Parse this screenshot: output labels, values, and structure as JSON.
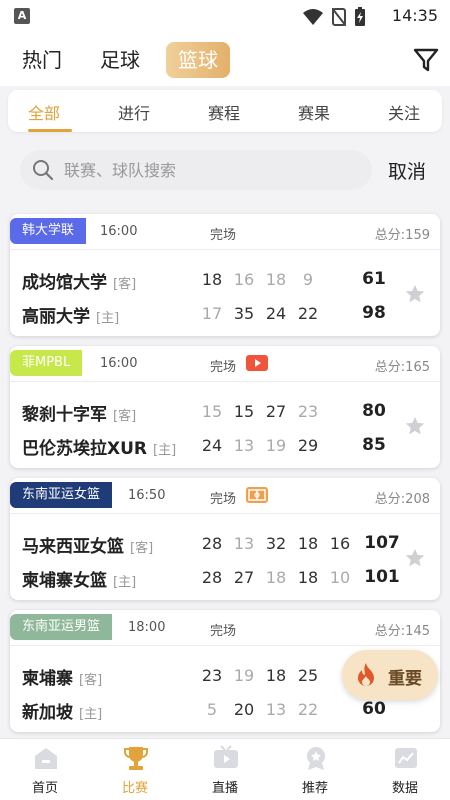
{
  "statusbar": {
    "app_badge": "A",
    "time": "14:35"
  },
  "top_tabs": [
    "热门",
    "足球",
    "篮球"
  ],
  "top_active": "篮球",
  "sub_tabs": [
    "全部",
    "进行",
    "赛程",
    "赛果",
    "关注"
  ],
  "search": {
    "placeholder": "联赛、球队搜索",
    "cancel": "取消"
  },
  "matches": [
    {
      "league": "韩大学联",
      "league_color": "#5b6ae8",
      "time": "16:00",
      "status": "完场",
      "total": "总分:159",
      "away": {
        "name": "成均馆大学",
        "side": "[客]",
        "q": [
          "18",
          "16",
          "18",
          "9"
        ],
        "total": "61"
      },
      "home": {
        "name": "高丽大学",
        "side": "[主]",
        "q": [
          "17",
          "35",
          "24",
          "22"
        ],
        "total": "98"
      }
    },
    {
      "league": "菲MPBL",
      "league_color": "#c7e84a",
      "time": "16:00",
      "status": "完场",
      "icon": "video-icon",
      "total": "总分:165",
      "away": {
        "name": "黎刹十字军",
        "side": "[客]",
        "q": [
          "15",
          "15",
          "27",
          "23"
        ],
        "total": "80"
      },
      "home": {
        "name": "巴伦苏埃拉XUR",
        "side": "[主]",
        "q": [
          "24",
          "13",
          "19",
          "29"
        ],
        "total": "85"
      }
    },
    {
      "league": "东南亚运女篮",
      "league_color": "#1f3b78",
      "time": "16:50",
      "status": "完场",
      "icon": "court-icon",
      "total": "总分:208",
      "away": {
        "name": "马来西亚女篮",
        "side": "[客]",
        "q": [
          "28",
          "13",
          "32",
          "18",
          "16"
        ],
        "total": "107"
      },
      "home": {
        "name": "柬埔寨女篮",
        "side": "[主]",
        "q": [
          "28",
          "27",
          "18",
          "18",
          "10"
        ],
        "total": "101"
      }
    },
    {
      "league": "东南亚运男篮",
      "league_color": "#8fb89a",
      "time": "18:00",
      "status": "完场",
      "total": "总分:145",
      "away": {
        "name": "柬埔寨",
        "side": "[客]",
        "q": [
          "23",
          "19",
          "18",
          "25"
        ],
        "total": ""
      },
      "home": {
        "name": "新加坡",
        "side": "[主]",
        "q": [
          "5",
          "20",
          "13",
          "22"
        ],
        "total": "60"
      }
    }
  ],
  "fab": {
    "label": "重要"
  },
  "bottom_nav": [
    {
      "label": "首页",
      "icon": "home-icon"
    },
    {
      "label": "比赛",
      "icon": "trophy-icon"
    },
    {
      "label": "直播",
      "icon": "tv-icon"
    },
    {
      "label": "推荐",
      "icon": "recommend-icon"
    },
    {
      "label": "数据",
      "icon": "chart-icon"
    }
  ],
  "colors": {
    "accent": "#e2a33a",
    "tab_gold": "#e3b06a",
    "video_red": "#f0553c",
    "court_orange": "#f0a04a"
  }
}
